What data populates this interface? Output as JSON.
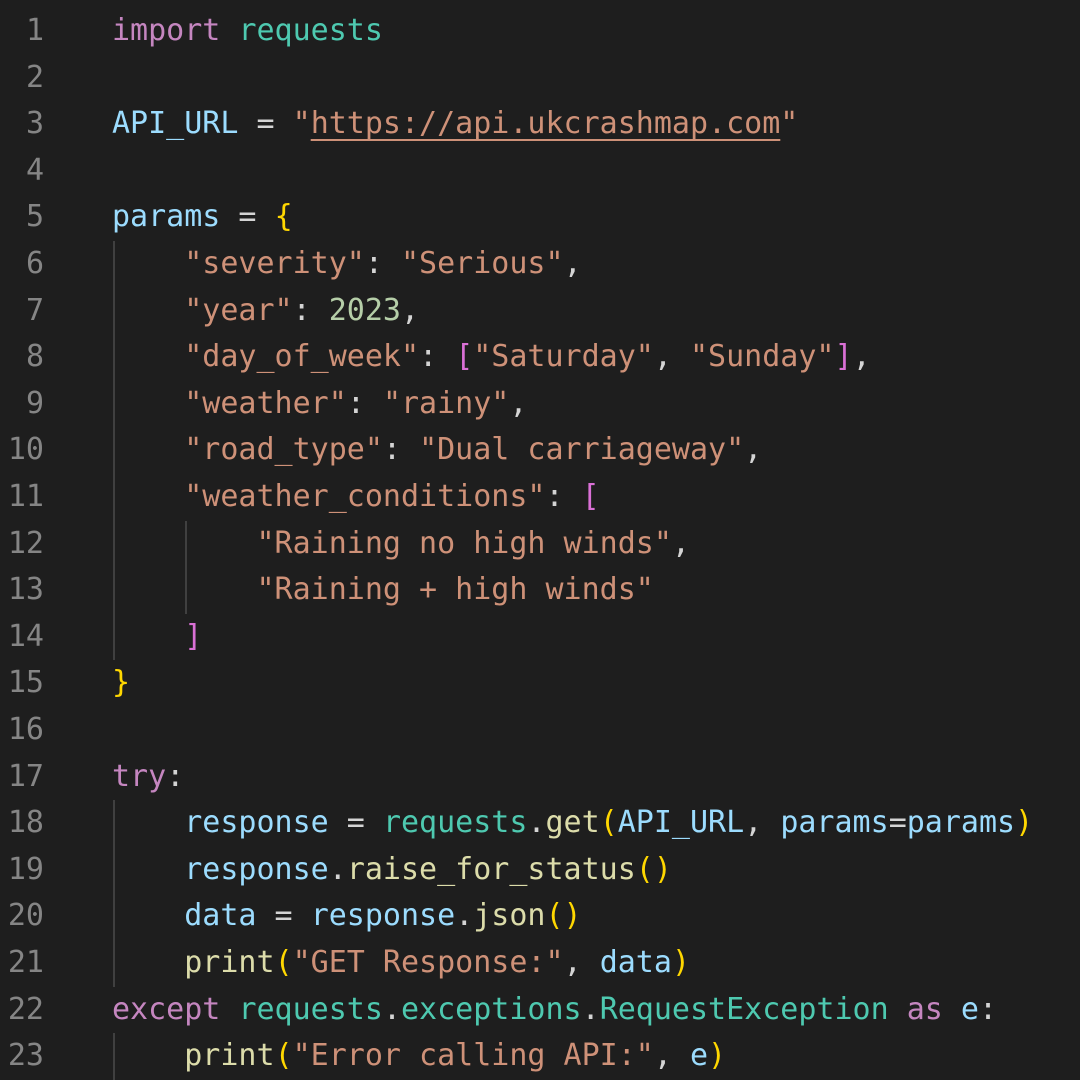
{
  "editor": {
    "language": "python",
    "line_numbers": [
      "1",
      "2",
      "3",
      "4",
      "5",
      "6",
      "7",
      "8",
      "9",
      "10",
      "11",
      "12",
      "13",
      "14",
      "15",
      "16",
      "17",
      "18",
      "19",
      "20",
      "21",
      "22",
      "23"
    ],
    "colors": {
      "background": "#1e1e1e",
      "line_number": "#858585",
      "keyword": "#c586c0",
      "module": "#4ec9b0",
      "variable": "#9cdcfe",
      "string": "#ce9178",
      "number": "#b5cea8",
      "function": "#dcdcaa",
      "bracket_level1": "#ffd700",
      "bracket_level2": "#da70d6",
      "indent_guide": "#404040"
    },
    "lines": [
      {
        "tokens": [
          {
            "t": "import",
            "c": "kw"
          },
          {
            "t": " ",
            "c": "op"
          },
          {
            "t": "requests",
            "c": "mod"
          }
        ]
      },
      {
        "tokens": []
      },
      {
        "tokens": [
          {
            "t": "API_URL",
            "c": "var"
          },
          {
            "t": " = ",
            "c": "op"
          },
          {
            "t": "\"",
            "c": "str"
          },
          {
            "t": "https://api.ukcrashmap.com",
            "c": "str",
            "link": true
          },
          {
            "t": "\"",
            "c": "str"
          }
        ]
      },
      {
        "tokens": []
      },
      {
        "tokens": [
          {
            "t": "params",
            "c": "var"
          },
          {
            "t": " = ",
            "c": "op"
          },
          {
            "t": "{",
            "c": "b1"
          }
        ]
      },
      {
        "tokens": [
          {
            "t": "    ",
            "c": "op"
          },
          {
            "t": "\"severity\"",
            "c": "str"
          },
          {
            "t": ": ",
            "c": "op"
          },
          {
            "t": "\"Serious\"",
            "c": "str"
          },
          {
            "t": ",",
            "c": "op"
          }
        ]
      },
      {
        "tokens": [
          {
            "t": "    ",
            "c": "op"
          },
          {
            "t": "\"year\"",
            "c": "str"
          },
          {
            "t": ": ",
            "c": "op"
          },
          {
            "t": "2023",
            "c": "num"
          },
          {
            "t": ",",
            "c": "op"
          }
        ]
      },
      {
        "tokens": [
          {
            "t": "    ",
            "c": "op"
          },
          {
            "t": "\"day_of_week\"",
            "c": "str"
          },
          {
            "t": ": ",
            "c": "op"
          },
          {
            "t": "[",
            "c": "b2"
          },
          {
            "t": "\"Saturday\"",
            "c": "str"
          },
          {
            "t": ", ",
            "c": "op"
          },
          {
            "t": "\"Sunday\"",
            "c": "str"
          },
          {
            "t": "]",
            "c": "b2"
          },
          {
            "t": ",",
            "c": "op"
          }
        ]
      },
      {
        "tokens": [
          {
            "t": "    ",
            "c": "op"
          },
          {
            "t": "\"weather\"",
            "c": "str"
          },
          {
            "t": ": ",
            "c": "op"
          },
          {
            "t": "\"rainy\"",
            "c": "str"
          },
          {
            "t": ",",
            "c": "op"
          }
        ]
      },
      {
        "tokens": [
          {
            "t": "    ",
            "c": "op"
          },
          {
            "t": "\"road_type\"",
            "c": "str"
          },
          {
            "t": ": ",
            "c": "op"
          },
          {
            "t": "\"Dual carriageway\"",
            "c": "str"
          },
          {
            "t": ",",
            "c": "op"
          }
        ]
      },
      {
        "tokens": [
          {
            "t": "    ",
            "c": "op"
          },
          {
            "t": "\"weather_conditions\"",
            "c": "str"
          },
          {
            "t": ": ",
            "c": "op"
          },
          {
            "t": "[",
            "c": "b2"
          }
        ]
      },
      {
        "tokens": [
          {
            "t": "        ",
            "c": "op"
          },
          {
            "t": "\"Raining no high winds\"",
            "c": "str"
          },
          {
            "t": ",",
            "c": "op"
          }
        ]
      },
      {
        "tokens": [
          {
            "t": "        ",
            "c": "op"
          },
          {
            "t": "\"Raining + high winds\"",
            "c": "str"
          }
        ]
      },
      {
        "tokens": [
          {
            "t": "    ",
            "c": "op"
          },
          {
            "t": "]",
            "c": "b2"
          }
        ]
      },
      {
        "tokens": [
          {
            "t": "}",
            "c": "b1"
          }
        ]
      },
      {
        "tokens": []
      },
      {
        "tokens": [
          {
            "t": "try",
            "c": "kw"
          },
          {
            "t": ":",
            "c": "op"
          }
        ]
      },
      {
        "tokens": [
          {
            "t": "    ",
            "c": "op"
          },
          {
            "t": "response",
            "c": "var"
          },
          {
            "t": " = ",
            "c": "op"
          },
          {
            "t": "requests",
            "c": "mod"
          },
          {
            "t": ".",
            "c": "op"
          },
          {
            "t": "get",
            "c": "fn"
          },
          {
            "t": "(",
            "c": "b1"
          },
          {
            "t": "API_URL",
            "c": "var"
          },
          {
            "t": ", ",
            "c": "op"
          },
          {
            "t": "params",
            "c": "var"
          },
          {
            "t": "=",
            "c": "op"
          },
          {
            "t": "params",
            "c": "var"
          },
          {
            "t": ")",
            "c": "b1"
          }
        ]
      },
      {
        "tokens": [
          {
            "t": "    ",
            "c": "op"
          },
          {
            "t": "response",
            "c": "var"
          },
          {
            "t": ".",
            "c": "op"
          },
          {
            "t": "raise_for_status",
            "c": "fn"
          },
          {
            "t": "()",
            "c": "b1"
          }
        ]
      },
      {
        "tokens": [
          {
            "t": "    ",
            "c": "op"
          },
          {
            "t": "data",
            "c": "var"
          },
          {
            "t": " = ",
            "c": "op"
          },
          {
            "t": "response",
            "c": "var"
          },
          {
            "t": ".",
            "c": "op"
          },
          {
            "t": "json",
            "c": "fn"
          },
          {
            "t": "()",
            "c": "b1"
          }
        ]
      },
      {
        "tokens": [
          {
            "t": "    ",
            "c": "op"
          },
          {
            "t": "print",
            "c": "fn"
          },
          {
            "t": "(",
            "c": "b1"
          },
          {
            "t": "\"GET Response:\"",
            "c": "str"
          },
          {
            "t": ", ",
            "c": "op"
          },
          {
            "t": "data",
            "c": "var"
          },
          {
            "t": ")",
            "c": "b1"
          }
        ]
      },
      {
        "tokens": [
          {
            "t": "except",
            "c": "kw"
          },
          {
            "t": " ",
            "c": "op"
          },
          {
            "t": "requests",
            "c": "mod"
          },
          {
            "t": ".",
            "c": "op"
          },
          {
            "t": "exceptions",
            "c": "mod"
          },
          {
            "t": ".",
            "c": "op"
          },
          {
            "t": "RequestException",
            "c": "mod"
          },
          {
            "t": " ",
            "c": "op"
          },
          {
            "t": "as",
            "c": "kw"
          },
          {
            "t": " ",
            "c": "op"
          },
          {
            "t": "e",
            "c": "var"
          },
          {
            "t": ":",
            "c": "op"
          }
        ]
      },
      {
        "tokens": [
          {
            "t": "    ",
            "c": "op"
          },
          {
            "t": "print",
            "c": "fn"
          },
          {
            "t": "(",
            "c": "b1"
          },
          {
            "t": "\"Error calling API:\"",
            "c": "str"
          },
          {
            "t": ", ",
            "c": "op"
          },
          {
            "t": "e",
            "c": "var"
          },
          {
            "t": ")",
            "c": "b1"
          }
        ]
      }
    ]
  }
}
